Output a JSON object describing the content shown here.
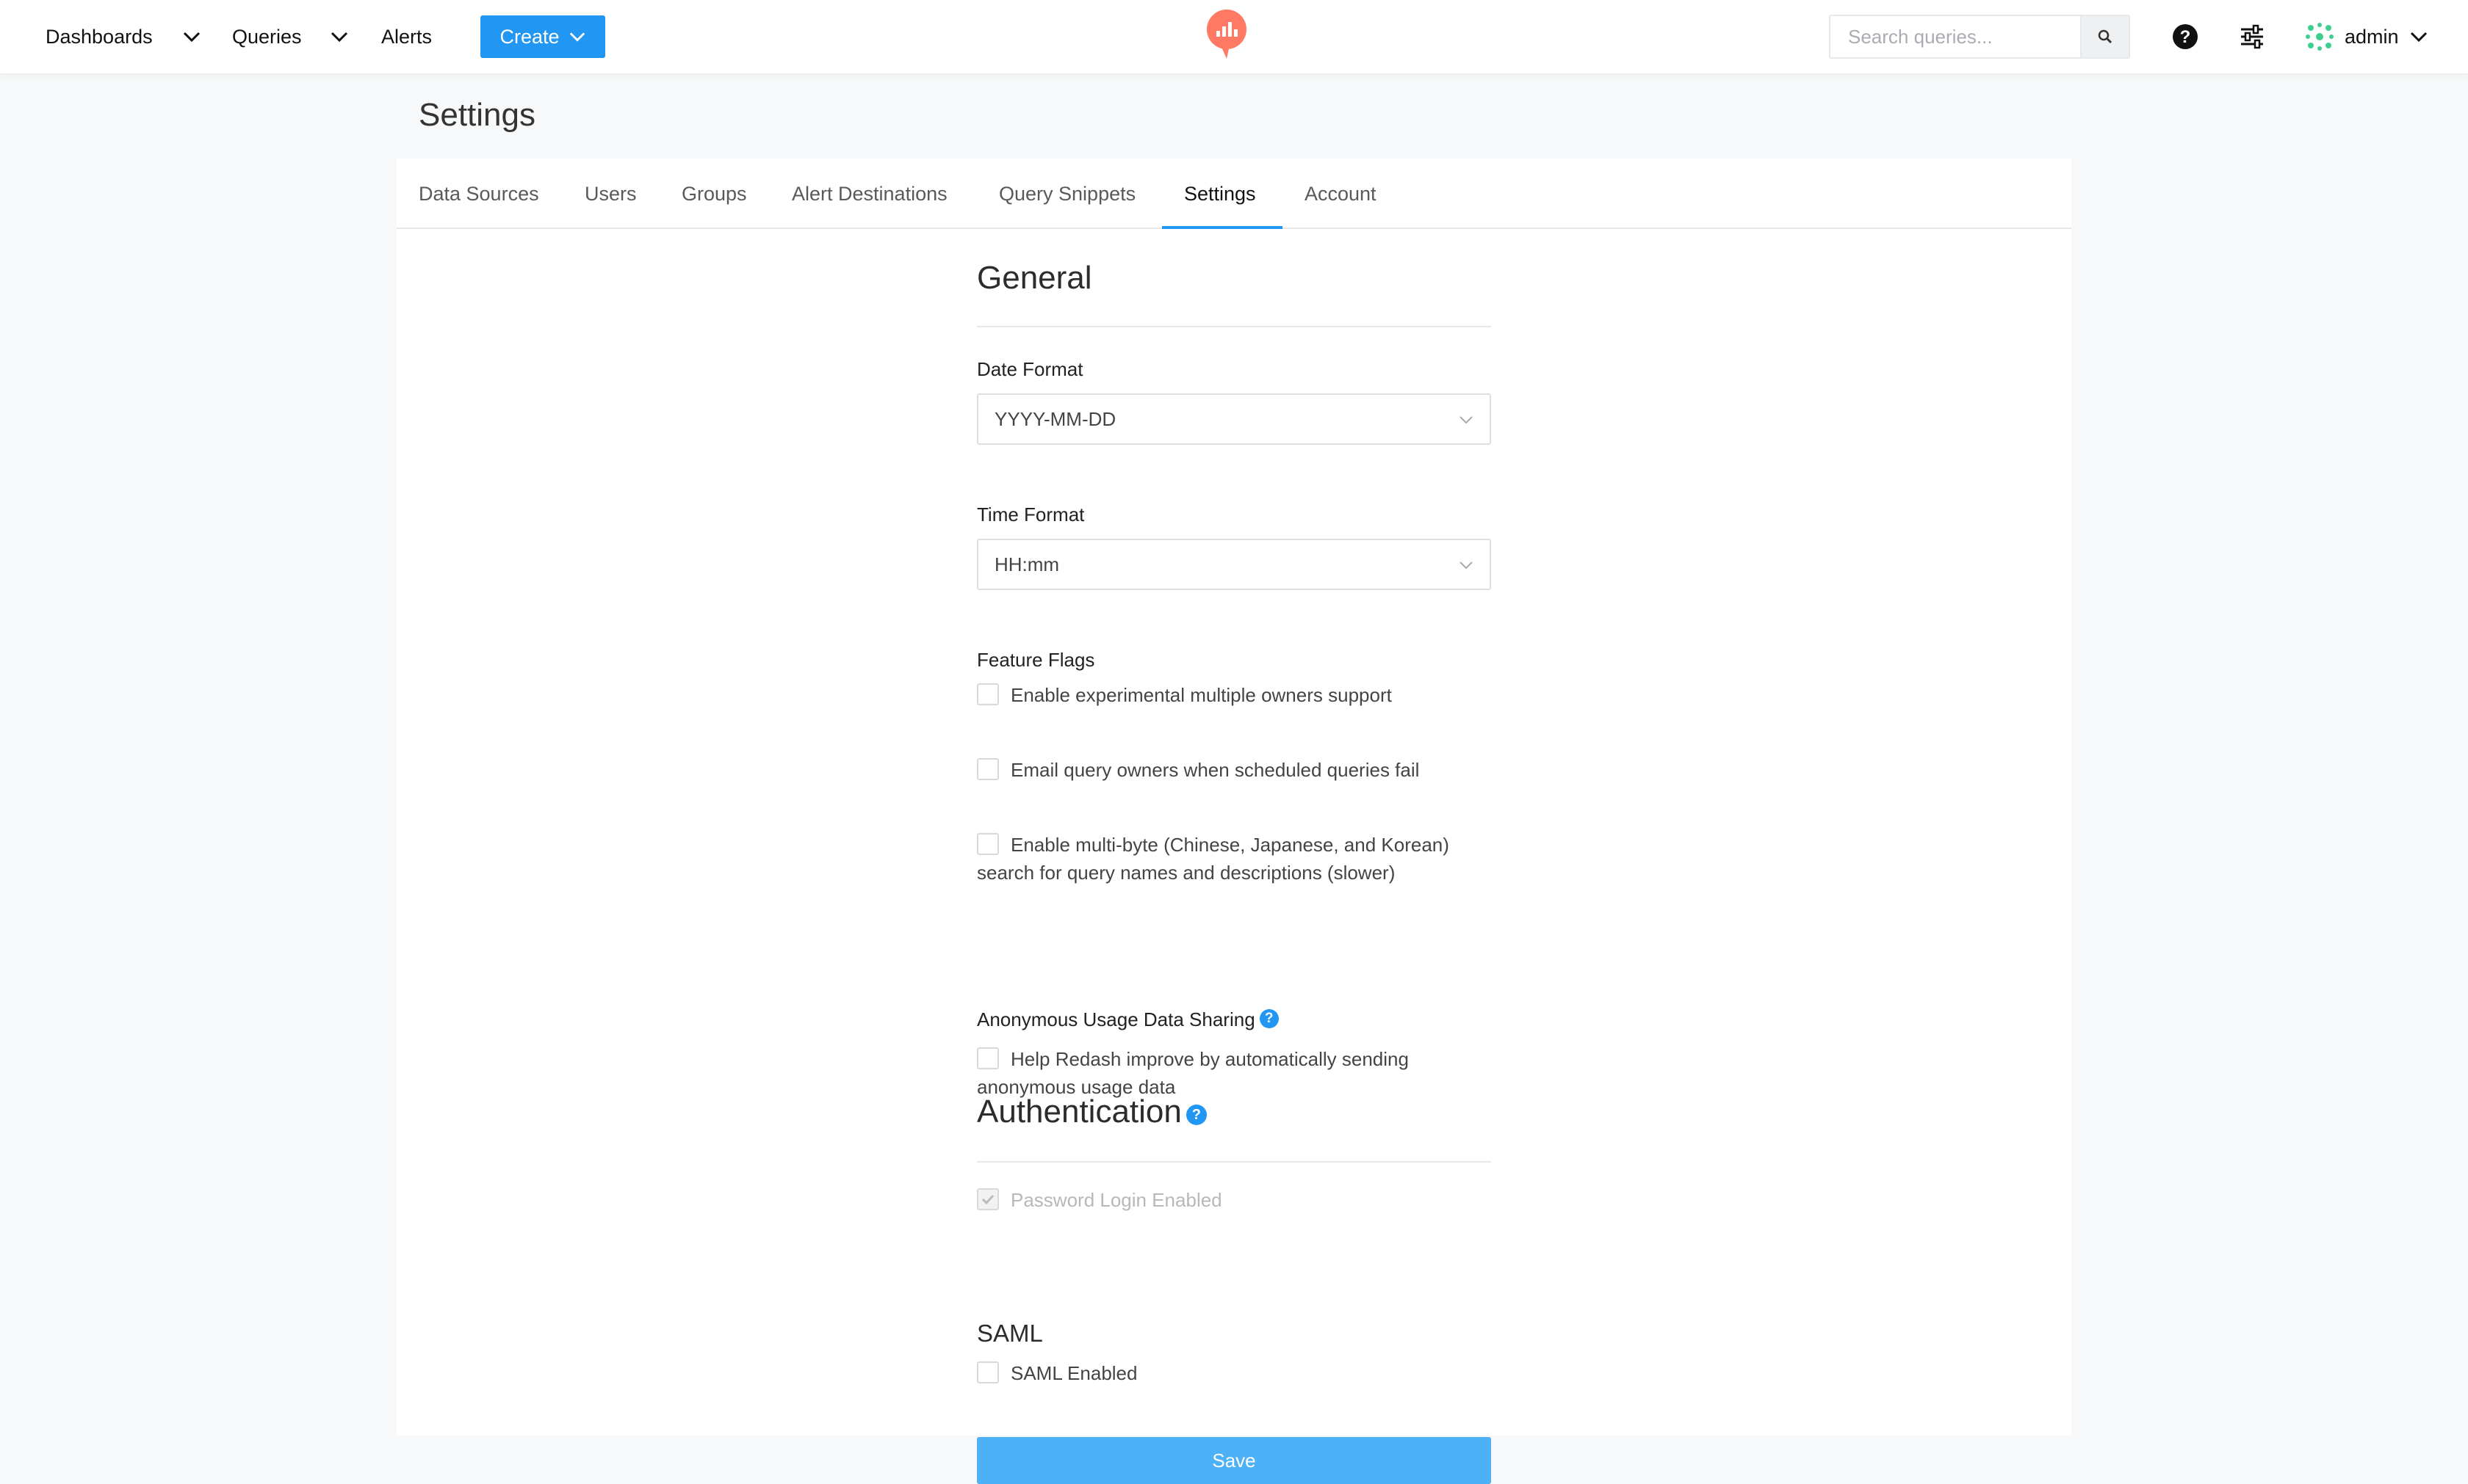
{
  "nav": {
    "dashboards": "Dashboards",
    "queries": "Queries",
    "alerts": "Alerts",
    "create": "Create",
    "search_placeholder": "Search queries...",
    "username": "admin"
  },
  "page": {
    "title": "Settings"
  },
  "tabs": [
    {
      "label": "Data Sources"
    },
    {
      "label": "Users"
    },
    {
      "label": "Groups"
    },
    {
      "label": "Alert Destinations"
    },
    {
      "label": "Query Snippets"
    },
    {
      "label": "Settings",
      "active": true
    },
    {
      "label": "Account"
    }
  ],
  "general": {
    "title": "General",
    "date_format_label": "Date Format",
    "date_format_value": "YYYY-MM-DD",
    "time_format_label": "Time Format",
    "time_format_value": "HH:mm",
    "feature_flags_label": "Feature Flags",
    "flags": [
      {
        "label": "Enable experimental multiple owners support",
        "checked": false
      },
      {
        "label": "Email query owners when scheduled queries fail",
        "checked": false
      },
      {
        "label": "Enable multi-byte (Chinese, Japanese, and Korean) search for query names and descriptions (slower)",
        "checked": false
      }
    ],
    "usage_label": "Anonymous Usage Data Sharing",
    "usage_checkbox": "Help Redash improve by automatically sending anonymous usage data"
  },
  "authentication": {
    "title": "Authentication",
    "password_login": "Password Login Enabled",
    "saml_title": "SAML",
    "saml_enabled": "SAML Enabled"
  },
  "save_label": "Save",
  "colors": {
    "primary": "#2196f3",
    "save": "#4db1f7",
    "logo": "#ff7964"
  }
}
